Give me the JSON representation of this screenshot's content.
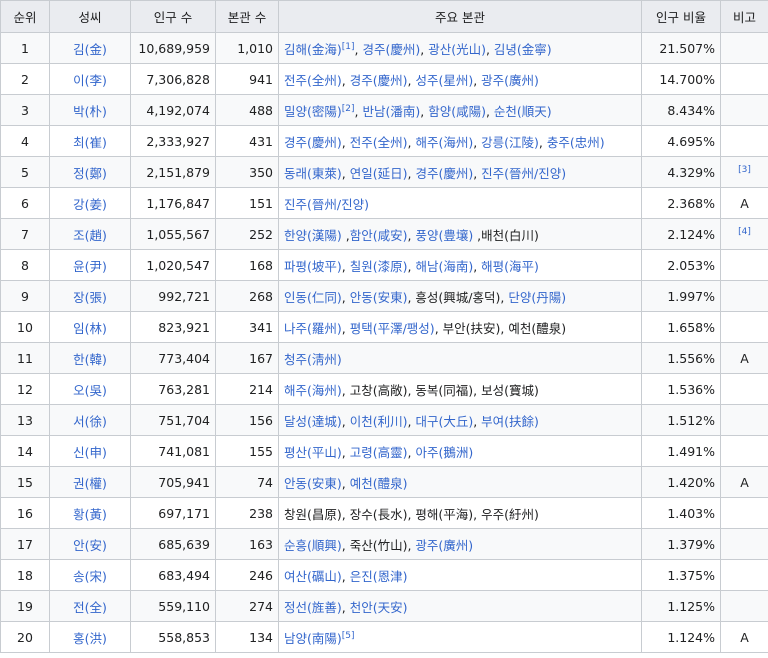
{
  "headers": [
    "순위",
    "성씨",
    "인구 수",
    "본관 수",
    "주요 본관",
    "인구 비율",
    "비고"
  ],
  "rows": [
    {
      "rank": "1",
      "surname": "김(金)",
      "population": "10,689,959",
      "clan_count": "1,010",
      "clans": [
        {
          "text": "김해(金海)",
          "link": true,
          "sup": "[1]"
        },
        {
          "text": ", ",
          "link": false
        },
        {
          "text": "경주(慶州)",
          "link": true
        },
        {
          "text": ", ",
          "link": false
        },
        {
          "text": "광산(光山)",
          "link": true
        },
        {
          "text": ", ",
          "link": false
        },
        {
          "text": "김녕(金寧)",
          "link": true
        }
      ],
      "ratio": "21.507%",
      "note": ""
    },
    {
      "rank": "2",
      "surname": "이(李)",
      "population": "7,306,828",
      "clan_count": "941",
      "clans": [
        {
          "text": "전주(全州)",
          "link": true
        },
        {
          "text": ", ",
          "link": false
        },
        {
          "text": "경주(慶州)",
          "link": true
        },
        {
          "text": ", ",
          "link": false
        },
        {
          "text": "성주(星州)",
          "link": true
        },
        {
          "text": ", ",
          "link": false
        },
        {
          "text": "광주(廣州)",
          "link": true
        }
      ],
      "ratio": "14.700%",
      "note": ""
    },
    {
      "rank": "3",
      "surname": "박(朴)",
      "population": "4,192,074",
      "clan_count": "488",
      "clans": [
        {
          "text": "밀양(密陽)",
          "link": true,
          "sup": "[2]"
        },
        {
          "text": ", ",
          "link": false
        },
        {
          "text": "반남(潘南)",
          "link": true
        },
        {
          "text": ", ",
          "link": false
        },
        {
          "text": "함양(咸陽)",
          "link": true
        },
        {
          "text": ", ",
          "link": false
        },
        {
          "text": "순천(順天)",
          "link": true
        }
      ],
      "ratio": "8.434%",
      "note": ""
    },
    {
      "rank": "4",
      "surname": "최(崔)",
      "population": "2,333,927",
      "clan_count": "431",
      "clans": [
        {
          "text": "경주(慶州)",
          "link": true
        },
        {
          "text": ", ",
          "link": false
        },
        {
          "text": "전주(全州)",
          "link": true
        },
        {
          "text": ", ",
          "link": false
        },
        {
          "text": "해주(海州)",
          "link": true
        },
        {
          "text": ", ",
          "link": false
        },
        {
          "text": "강릉(江陵)",
          "link": true
        },
        {
          "text": ", ",
          "link": false
        },
        {
          "text": "충주(忠州)",
          "link": true
        }
      ],
      "ratio": "4.695%",
      "note": ""
    },
    {
      "rank": "5",
      "surname": "정(鄭)",
      "population": "2,151,879",
      "clan_count": "350",
      "clans": [
        {
          "text": "동래(東萊)",
          "link": true
        },
        {
          "text": ", ",
          "link": false
        },
        {
          "text": "연일(延日)",
          "link": true
        },
        {
          "text": ", ",
          "link": false
        },
        {
          "text": "경주(慶州)",
          "link": true
        },
        {
          "text": ", ",
          "link": false
        },
        {
          "text": "진주(晉州/진양)",
          "link": true
        }
      ],
      "ratio": "4.329%",
      "note": "[3]"
    },
    {
      "rank": "6",
      "surname": "강(姜)",
      "population": "1,176,847",
      "clan_count": "151",
      "clans": [
        {
          "text": "진주(晉州/진양)",
          "link": true
        }
      ],
      "ratio": "2.368%",
      "note": "A"
    },
    {
      "rank": "7",
      "surname": "조(趙)",
      "population": "1,055,567",
      "clan_count": "252",
      "clans": [
        {
          "text": "한양(漢陽)",
          "link": true
        },
        {
          "text": " ,",
          "link": false
        },
        {
          "text": "함안(咸安)",
          "link": true
        },
        {
          "text": ", ",
          "link": false
        },
        {
          "text": "풍양(豊壤)",
          "link": true
        },
        {
          "text": " ,배천(白川)",
          "link": false
        }
      ],
      "ratio": "2.124%",
      "note": "[4]"
    },
    {
      "rank": "8",
      "surname": "윤(尹)",
      "population": "1,020,547",
      "clan_count": "168",
      "clans": [
        {
          "text": "파평(坡平)",
          "link": true
        },
        {
          "text": ", ",
          "link": false
        },
        {
          "text": "칠원(漆原)",
          "link": true
        },
        {
          "text": ", ",
          "link": false
        },
        {
          "text": "해남(海南)",
          "link": true
        },
        {
          "text": ", ",
          "link": false
        },
        {
          "text": "해평(海平)",
          "link": true
        }
      ],
      "ratio": "2.053%",
      "note": ""
    },
    {
      "rank": "9",
      "surname": "장(張)",
      "population": "992,721",
      "clan_count": "268",
      "clans": [
        {
          "text": "인동(仁同)",
          "link": true
        },
        {
          "text": ", ",
          "link": false
        },
        {
          "text": "안동(安東)",
          "link": true
        },
        {
          "text": ", 흥성(興城/홍덕), ",
          "link": false
        },
        {
          "text": "단양(丹陽)",
          "link": true
        }
      ],
      "ratio": "1.997%",
      "note": ""
    },
    {
      "rank": "10",
      "surname": "임(林)",
      "population": "823,921",
      "clan_count": "341",
      "clans": [
        {
          "text": "나주(羅州)",
          "link": true
        },
        {
          "text": ", ",
          "link": false
        },
        {
          "text": "평택(平澤/팽성)",
          "link": true
        },
        {
          "text": ", 부안(扶安), 예천(醴泉)",
          "link": false
        }
      ],
      "ratio": "1.658%",
      "note": ""
    },
    {
      "rank": "11",
      "surname": "한(韓)",
      "population": "773,404",
      "clan_count": "167",
      "clans": [
        {
          "text": "청주(淸州)",
          "link": true
        }
      ],
      "ratio": "1.556%",
      "note": "A"
    },
    {
      "rank": "12",
      "surname": "오(吳)",
      "population": "763,281",
      "clan_count": "214",
      "clans": [
        {
          "text": "해주(海州)",
          "link": true
        },
        {
          "text": ", 고창(高敞), 동복(同福), 보성(寶城)",
          "link": false
        }
      ],
      "ratio": "1.536%",
      "note": ""
    },
    {
      "rank": "13",
      "surname": "서(徐)",
      "population": "751,704",
      "clan_count": "156",
      "clans": [
        {
          "text": "달성(達城)",
          "link": true
        },
        {
          "text": ", ",
          "link": false
        },
        {
          "text": "이천(利川)",
          "link": true
        },
        {
          "text": ", ",
          "link": false
        },
        {
          "text": "대구(大丘)",
          "link": true
        },
        {
          "text": ", ",
          "link": false
        },
        {
          "text": "부여(扶餘)",
          "link": true
        }
      ],
      "ratio": "1.512%",
      "note": ""
    },
    {
      "rank": "14",
      "surname": "신(申)",
      "population": "741,081",
      "clan_count": "155",
      "clans": [
        {
          "text": "평산(平山)",
          "link": true
        },
        {
          "text": ", ",
          "link": false
        },
        {
          "text": "고령(高靈)",
          "link": true
        },
        {
          "text": ", ",
          "link": false
        },
        {
          "text": "아주(鵝洲)",
          "link": true
        }
      ],
      "ratio": "1.491%",
      "note": ""
    },
    {
      "rank": "15",
      "surname": "권(權)",
      "population": "705,941",
      "clan_count": "74",
      "clans": [
        {
          "text": "안동(安東)",
          "link": true
        },
        {
          "text": ", ",
          "link": false
        },
        {
          "text": "예천(醴泉)",
          "link": true
        }
      ],
      "ratio": "1.420%",
      "note": "A"
    },
    {
      "rank": "16",
      "surname": "황(黃)",
      "population": "697,171",
      "clan_count": "238",
      "clans": [
        {
          "text": "창원(昌原), 장수(長水), 평해(平海), 우주(紆州)",
          "link": false
        }
      ],
      "ratio": "1.403%",
      "note": ""
    },
    {
      "rank": "17",
      "surname": "안(安)",
      "population": "685,639",
      "clan_count": "163",
      "clans": [
        {
          "text": "순흥(順興)",
          "link": true
        },
        {
          "text": ", 죽산(竹山), ",
          "link": false
        },
        {
          "text": "광주(廣州)",
          "link": true
        }
      ],
      "ratio": "1.379%",
      "note": ""
    },
    {
      "rank": "18",
      "surname": "송(宋)",
      "population": "683,494",
      "clan_count": "246",
      "clans": [
        {
          "text": "여산(礪山)",
          "link": true
        },
        {
          "text": ", ",
          "link": false
        },
        {
          "text": "은진(恩津)",
          "link": true
        }
      ],
      "ratio": "1.375%",
      "note": ""
    },
    {
      "rank": "19",
      "surname": "전(全)",
      "population": "559,110",
      "clan_count": "274",
      "clans": [
        {
          "text": "정선(旌善)",
          "link": true
        },
        {
          "text": ", ",
          "link": false
        },
        {
          "text": "천안(天安)",
          "link": true
        }
      ],
      "ratio": "1.125%",
      "note": ""
    },
    {
      "rank": "20",
      "surname": "홍(洪)",
      "population": "558,853",
      "clan_count": "134",
      "clans": [
        {
          "text": "남양(南陽)",
          "link": true,
          "sup": "[5]"
        }
      ],
      "ratio": "1.124%",
      "note": "A"
    }
  ],
  "colors": {
    "link": "#3366cc",
    "header_bg": "#eaecf0",
    "border": "#c8ccd1",
    "stripe": "#f8f9fa"
  }
}
